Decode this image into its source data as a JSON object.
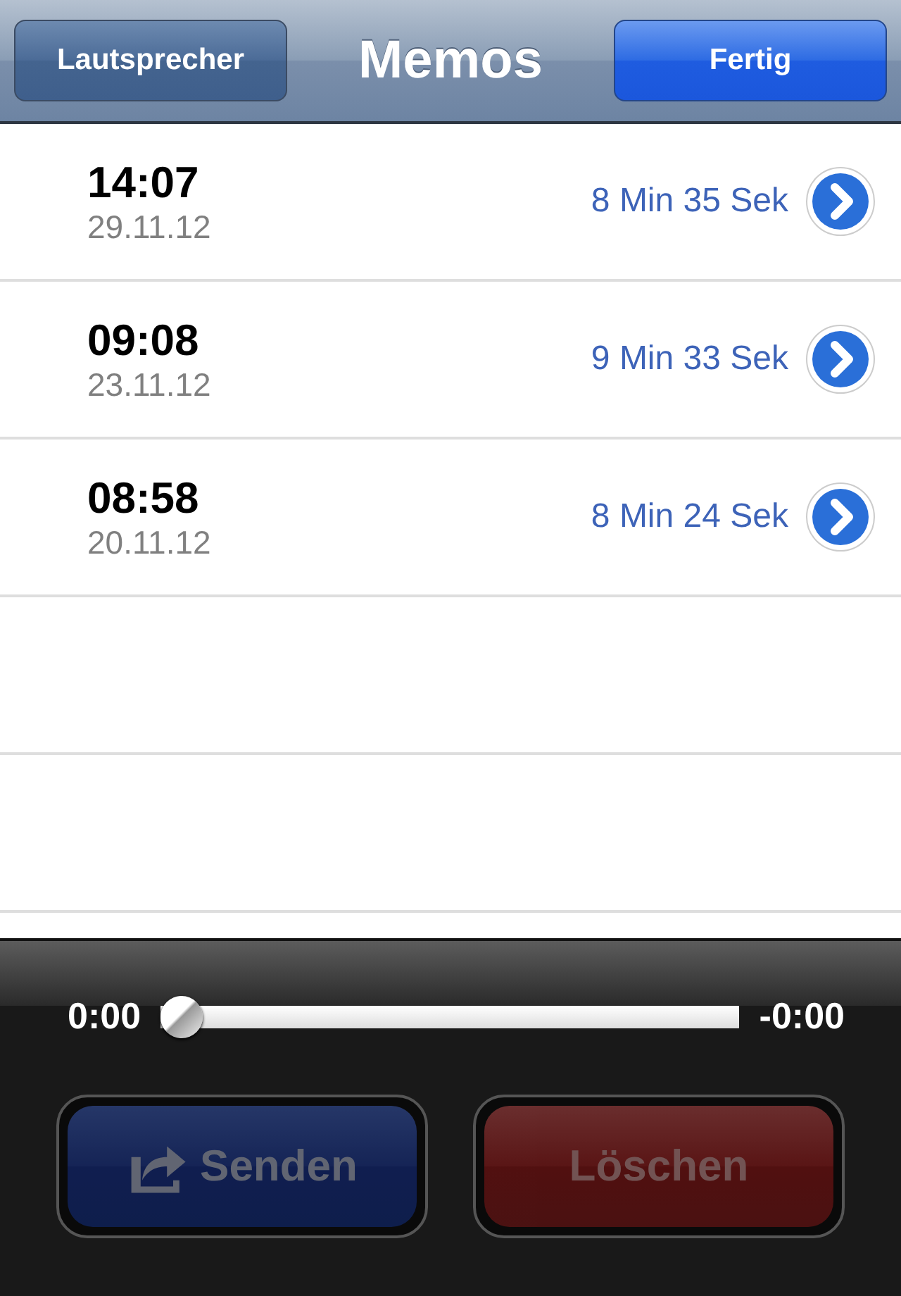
{
  "nav_bar": {
    "title": "Memos",
    "left_button": "Lautsprecher",
    "right_button": "Fertig"
  },
  "memos": [
    {
      "time": "14:07",
      "date": "29.11.12",
      "duration": "8 Min 35 Sek"
    },
    {
      "time": "09:08",
      "date": "23.11.12",
      "duration": "9 Min 33 Sek"
    },
    {
      "time": "08:58",
      "date": "20.11.12",
      "duration": "8 Min 24 Sek"
    }
  ],
  "player": {
    "elapsed": "0:00",
    "remaining": "-0:00",
    "level": 0
  },
  "actions": [
    {
      "label": "Senden",
      "kind": "send",
      "disabled": true
    },
    {
      "label": "Löschen",
      "kind": "delete",
      "disabled": true
    }
  ]
}
